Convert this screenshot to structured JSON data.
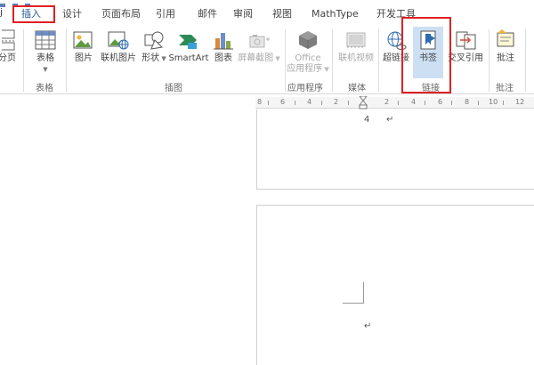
{
  "tabs": [
    {
      "label": "插入"
    },
    {
      "label": "设计"
    },
    {
      "label": "页面布局"
    },
    {
      "label": "引用"
    },
    {
      "label": "邮件"
    },
    {
      "label": "审阅"
    },
    {
      "label": "视图"
    },
    {
      "label": "MathType"
    },
    {
      "label": "开发工具"
    }
  ],
  "tab_left_char": "j",
  "ribbon": {
    "buttons": {
      "page_break": "分页",
      "table": "表格",
      "picture": "图片",
      "online_picture": "联机图片",
      "shapes": "形状",
      "smartart": "SmartArt",
      "chart": "图表",
      "screenshot": "屏幕截图",
      "office_apps_line1": "Office",
      "office_apps_line2": "应用程序",
      "online_video": "联机视频",
      "hyperlink": "超链接",
      "bookmark": "书签",
      "cross_reference": "交叉引用",
      "comment": "批注"
    },
    "groups": {
      "tables": "表格",
      "illustrations": "插图",
      "apps": "应用程序",
      "media": "媒体",
      "links": "链接",
      "comments": "批注"
    }
  },
  "ruler_labels": [
    "8",
    "6",
    "4",
    "2",
    "2",
    "4",
    "6",
    "8",
    "10",
    "12"
  ],
  "document": {
    "page_number": "4",
    "paragraph_mark": "↵"
  }
}
